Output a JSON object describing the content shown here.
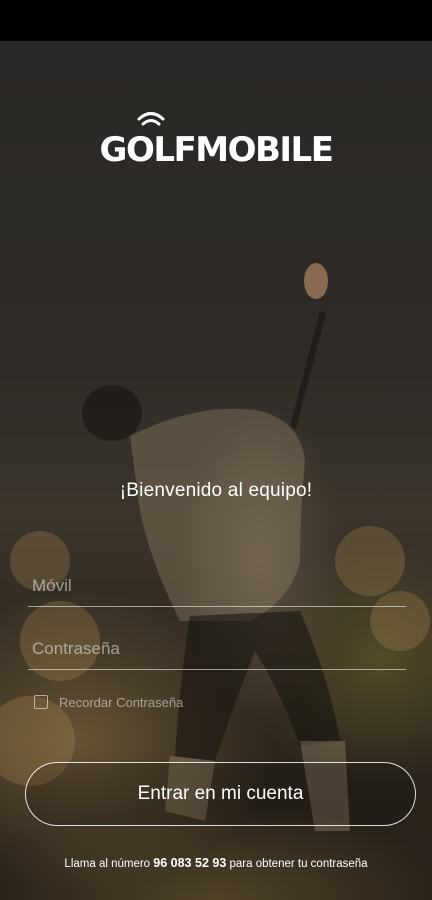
{
  "app": {
    "brand_name": "GOLFMOBILE"
  },
  "login": {
    "welcome": "¡Bienvenido al equipo!",
    "phone_placeholder": "Móvil",
    "password_placeholder": "Contraseña",
    "remember_label": "Recordar Contraseña",
    "remember_checked": false,
    "submit_label": "Entrar en mi cuenta"
  },
  "footer": {
    "text_before": "Llama al número ",
    "phone": "96 083 52 93",
    "text_after": " para obtener tu contraseña"
  },
  "icons": {
    "logo": "golfmobile-logo",
    "wifi": "wifi-icon"
  }
}
